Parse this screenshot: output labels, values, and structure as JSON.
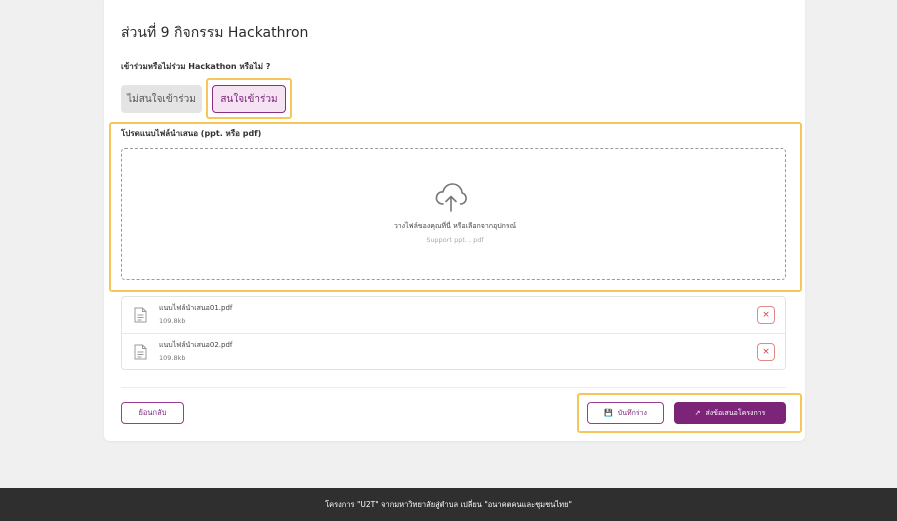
{
  "section": {
    "title": "ส่วนที่ 9  กิจกรรม Hackathron"
  },
  "question": {
    "label": "เข้าร่วมหรือไม่ร่วม Hackathon หรือไม่ ?",
    "options": [
      {
        "label": "ไม่สนใจเข้าร่วม",
        "selected": false
      },
      {
        "label": "สนใจเข้าร่วม",
        "selected": true
      }
    ]
  },
  "upload": {
    "label": "โปรดแนบไฟล์นำเสนอ (ppt. หรือ pdf)",
    "drop_text": "วางไฟล์ของคุณที่นี่ หรือเลือกจากอุปกรณ์",
    "support_text": "Support ppt. , pdf"
  },
  "files": [
    {
      "name": "แนบไฟล์นำเสนอ01.pdf",
      "size": "109.8kb",
      "remove_symbol": "×"
    },
    {
      "name": "แนบไฟล์นำเสนอ02.pdf",
      "size": "109.8kb",
      "remove_symbol": "×"
    }
  ],
  "actions": {
    "back_label": "ย้อนกลับ",
    "draft_label": "บันทึกร่าง",
    "draft_icon": "💾",
    "submit_label": "ส่งข้อเสนอโครงการ",
    "submit_icon": "↗"
  },
  "footer": {
    "text": "โครงการ  \"U2T\" จากมหาวิทยาลัยสู่ตำบล เปลี่ยน \"อนาคตคนและชุมชนไทย\""
  },
  "colors": {
    "brand": "#7b2478",
    "highlight": "#f5c75a",
    "footer_bg": "#2f2f2f",
    "remove": "#d04040"
  }
}
